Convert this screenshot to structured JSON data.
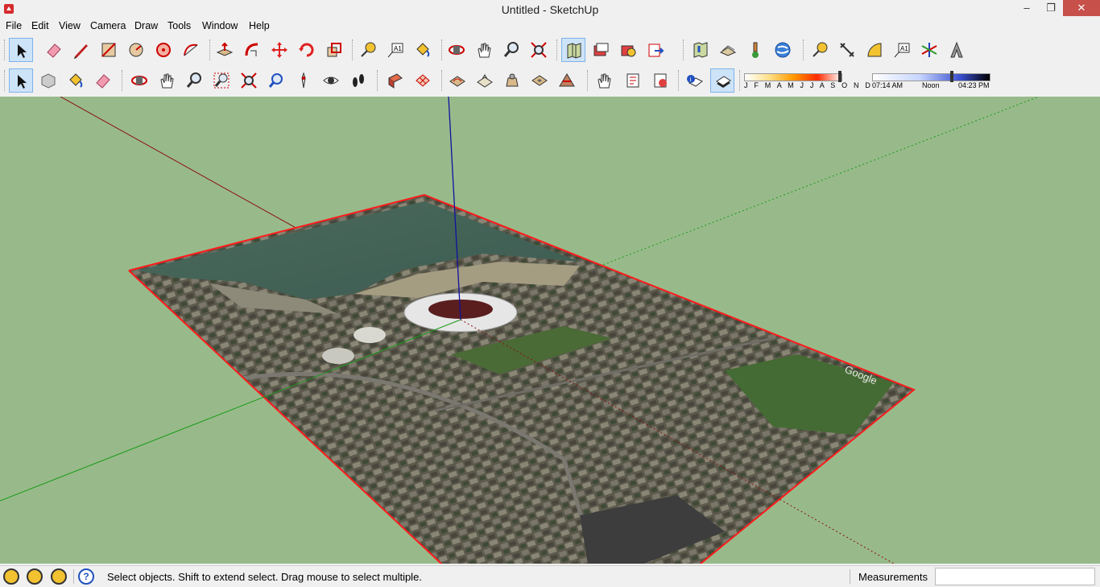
{
  "window": {
    "title": "Untitled - SketchUp",
    "minimize": "–",
    "restore": "❐",
    "close": "✕"
  },
  "menu": [
    "File",
    "Edit",
    "View",
    "Camera",
    "Draw",
    "Tools",
    "Window",
    "Help"
  ],
  "toolbar1": {
    "group1": [
      "select-tool",
      "eraser-tool",
      "pencil-line-tool",
      "rectangle-tool",
      "circle-tool",
      "polygon-tool",
      "arc-tool"
    ],
    "group2": [
      "push-pull-tool",
      "follow-me-tool",
      "move-tool",
      "rotate-tool",
      "scale-tool"
    ],
    "group3": [
      "tape-measure-tool",
      "text-tool",
      "paint-bucket-tool"
    ],
    "group4": [
      "orbit-tool",
      "pan-tool",
      "zoom-tool",
      "zoom-extents-tool"
    ],
    "group5": [
      "get-models-icon",
      "share-model-icon",
      "share-component-icon",
      "export-google-earth-icon"
    ],
    "group6": [
      "add-location-icon",
      "toggle-terrain-icon",
      "photo-textures-icon",
      "preview-google-earth-icon"
    ],
    "group7": [
      "tape-measure-icon",
      "dimension-icon",
      "protractor-icon",
      "text-label-icon",
      "axes-icon",
      "3d-text-icon"
    ]
  },
  "toolbar2": {
    "group1": [
      "select-tool",
      "make-component-icon",
      "paint-bucket-icon",
      "eraser-icon"
    ],
    "group2": [
      "orbit-icon",
      "pan-icon",
      "zoom-icon",
      "zoom-window-icon",
      "zoom-extents-icon",
      "previous-view-icon",
      "position-camera-icon",
      "look-around-icon",
      "walk-icon"
    ],
    "group3": [
      "section-plane-icon",
      "section-cut-icon"
    ],
    "group4": [
      "sandbox-from-contours-icon",
      "sandbox-from-scratch-icon",
      "smoove-icon",
      "stamp-icon",
      "drape-icon"
    ],
    "group5": [
      "hand-tool-icon",
      "add-scene-icon",
      "update-scene-icon"
    ],
    "group6": [
      "shadow-settings-icon",
      "display-shadows-icon"
    ]
  },
  "shadows": {
    "months": "J F M A M J J A S O N D",
    "time_start": "07:14 AM",
    "time_mid": "Noon",
    "time_end": "04:23 PM"
  },
  "statusbar": {
    "hint": "Select objects. Shift to extend select. Drag mouse to select multiple.",
    "measurements_label": "Measurements",
    "measurements_value": ""
  },
  "colors": {
    "viewport_bg": "#98ba8a",
    "red_axis": "#8a1010",
    "green_axis": "#1a9b1a",
    "blue_axis": "#1010a0",
    "selection": "#ff1a1a"
  },
  "map_watermark": "Google"
}
